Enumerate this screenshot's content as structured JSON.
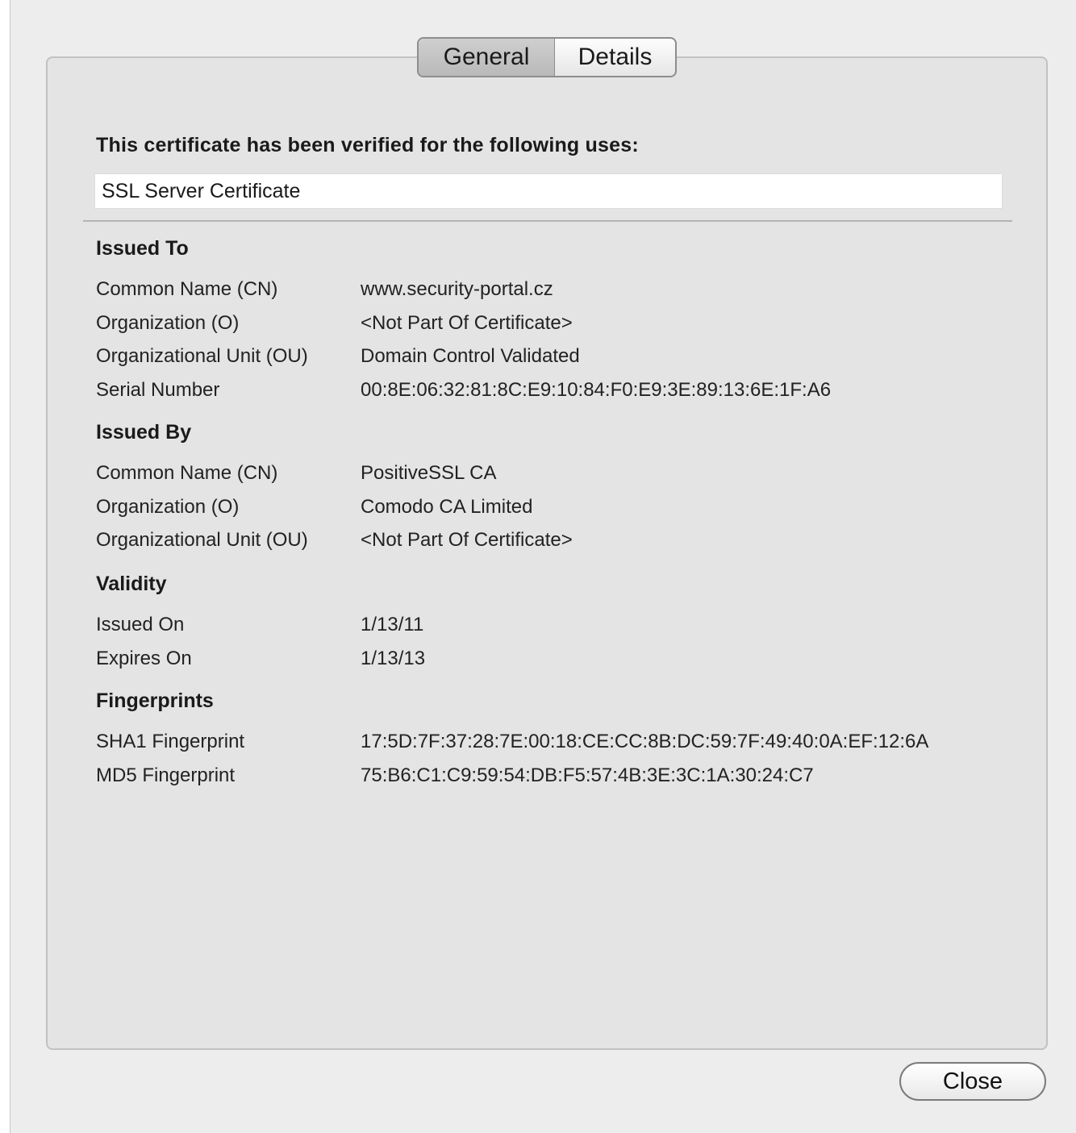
{
  "tabs": [
    {
      "label": "General",
      "selected": true
    },
    {
      "label": "Details",
      "selected": false
    }
  ],
  "verified_heading": "This certificate has been verified for the following uses:",
  "uses_value": "SSL Server Certificate",
  "sections": {
    "issued_to": {
      "title": "Issued To",
      "rows": [
        {
          "label": "Common Name (CN)",
          "value": "www.security-portal.cz"
        },
        {
          "label": "Organization (O)",
          "value": "<Not Part Of Certificate>"
        },
        {
          "label": "Organizational Unit (OU)",
          "value": "Domain Control Validated"
        },
        {
          "label": "Serial Number",
          "value": "00:8E:06:32:81:8C:E9:10:84:F0:E9:3E:89:13:6E:1F:A6"
        }
      ]
    },
    "issued_by": {
      "title": "Issued By",
      "rows": [
        {
          "label": "Common Name (CN)",
          "value": "PositiveSSL CA"
        },
        {
          "label": "Organization (O)",
          "value": "Comodo CA Limited"
        },
        {
          "label": "Organizational Unit (OU)",
          "value": "<Not Part Of Certificate>"
        }
      ]
    },
    "validity": {
      "title": "Validity",
      "rows": [
        {
          "label": "Issued On",
          "value": "1/13/11"
        },
        {
          "label": "Expires On",
          "value": "1/13/13"
        }
      ]
    },
    "fingerprints": {
      "title": "Fingerprints",
      "rows": [
        {
          "label": "SHA1 Fingerprint",
          "value": "17:5D:7F:37:28:7E:00:18:CE:CC:8B:DC:59:7F:49:40:0A:EF:12:6A"
        },
        {
          "label": "MD5 Fingerprint",
          "value": "75:B6:C1:C9:59:54:DB:F5:57:4B:3E:3C:1A:30:24:C7"
        }
      ]
    }
  },
  "close_label": "Close"
}
